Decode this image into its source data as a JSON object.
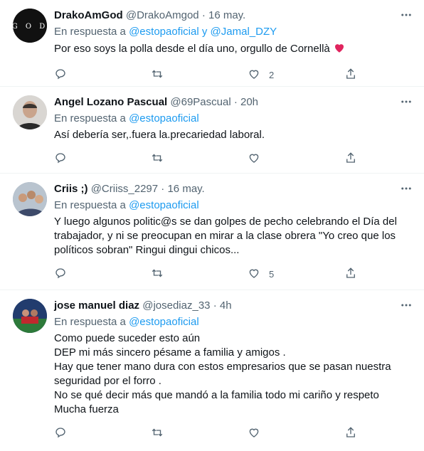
{
  "tweets": [
    {
      "name": "DrakoAmGod",
      "handle": "@DrakoAmgod",
      "sep": "·",
      "time": "16 may.",
      "reply_prefix": "En respuesta a",
      "mentions": [
        "@estopaoficial",
        "@Jamal_DZY"
      ],
      "mention_joiner": "y",
      "text": "Por eso soys la polla desde el día uno, orgullo de Cornellà",
      "emoji": "heart",
      "counts": {
        "reply": "",
        "retweet": "",
        "like": "2"
      },
      "avatar": {
        "bg": "#111111",
        "letters": "GOD"
      }
    },
    {
      "name": "Angel Lozano Pascual",
      "handle": "@69Pascual",
      "sep": "·",
      "time": "20h",
      "reply_prefix": "En respuesta a",
      "mentions": [
        "@estopaoficial"
      ],
      "text": "Así debería ser,.fuera la.precariedad laboral.",
      "counts": {
        "reply": "",
        "retweet": "",
        "like": ""
      },
      "avatar": {
        "bg": "#c9c9c9"
      }
    },
    {
      "name": "Criis ;)",
      "handle": "@Criiss_2297",
      "sep": "·",
      "time": "16 may.",
      "reply_prefix": "En respuesta a",
      "mentions": [
        "@estopaoficial"
      ],
      "text": "Y luego algunos politic@s se dan golpes de pecho celebrando el Día del trabajador, y ni se preocupan en mirar a la clase obrera \"Yo creo que los políticos sobran\" Ringui dingui chicos...",
      "counts": {
        "reply": "",
        "retweet": "",
        "like": "5"
      },
      "avatar": {
        "bg": "#9aa7b8"
      }
    },
    {
      "name": "jose manuel diaz",
      "handle": "@josediaz_33",
      "sep": "·",
      "time": "4h",
      "reply_prefix": "En respuesta a",
      "mentions": [
        "@estopaoficial"
      ],
      "lines": [
        "Como puede suceder esto aún",
        "DEP mi más sincero pésame a familia y amigos .",
        "Hay que tener mano dura con estos empresarios que se pasan nuestra seguridad por el forro .",
        "No se qué decir más que mandó a la familia todo mi cariño y respeto",
        "Mucha fuerza"
      ],
      "counts": {
        "reply": "",
        "retweet": "",
        "like": ""
      },
      "avatar": {
        "bg": "#1a3a6a"
      }
    }
  ],
  "colors": {
    "accent": "#1d9bf0",
    "muted": "#536471",
    "heart": "#f91880"
  },
  "icons": [
    "more-icon",
    "reply-icon",
    "retweet-icon",
    "like-icon",
    "share-icon"
  ]
}
